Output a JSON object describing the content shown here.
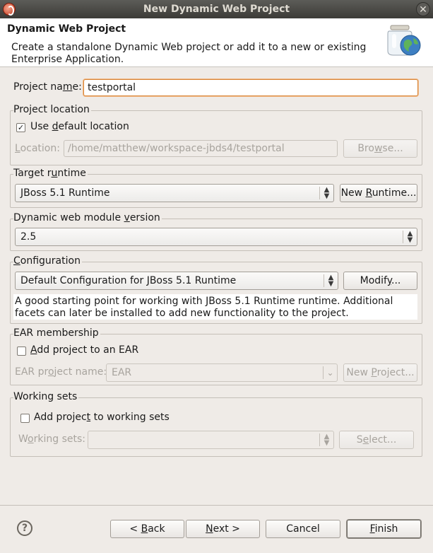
{
  "window": {
    "title": "New Dynamic Web Project"
  },
  "header": {
    "title": "Dynamic Web Project",
    "description": "Create a standalone Dynamic Web project or add it to a new or existing Enterprise Application."
  },
  "project_name": {
    "label_pre": "Project na",
    "label_mn": "m",
    "label_post": "e:",
    "value": "testportal"
  },
  "project_location": {
    "legend": "Project location",
    "use_default_pre": "Use ",
    "use_default_mn": "d",
    "use_default_post": "efault location",
    "use_default_checked": true,
    "location_pre": "",
    "location_mn": "L",
    "location_post": "ocation:",
    "location_value": "/home/matthew/workspace-jbds4/testportal",
    "browse_pre": "Bro",
    "browse_mn": "w",
    "browse_post": "se..."
  },
  "target_runtime": {
    "legend_pre": "Target r",
    "legend_mn": "u",
    "legend_post": "ntime",
    "selected": "JBoss 5.1 Runtime",
    "new_runtime_pre": "New ",
    "new_runtime_mn": "R",
    "new_runtime_post": "untime..."
  },
  "module_version": {
    "legend_pre": "Dynamic web module ",
    "legend_mn": "v",
    "legend_post": "ersion",
    "selected": "2.5"
  },
  "configuration": {
    "legend_pre": "",
    "legend_mn": "C",
    "legend_post": "onfiguration",
    "selected": "Default Configuration for JBoss 5.1 Runtime",
    "modify_pre": "Modif",
    "modify_mn": "y",
    "modify_post": "...",
    "description": "A good starting point for working with JBoss 5.1 Runtime runtime. Additional facets can later be installed to add new functionality to the project."
  },
  "ear": {
    "legend": "EAR membership",
    "add_pre": "",
    "add_mn": "A",
    "add_post": "dd project to an EAR",
    "add_checked": false,
    "ear_name_pre": "EAR pr",
    "ear_name_mn": "o",
    "ear_name_post": "ject name:",
    "ear_name_value": "EAR",
    "new_project_pre": "New ",
    "new_project_mn": "P",
    "new_project_post": "roject..."
  },
  "working_sets": {
    "legend": "Working sets",
    "add_pre": "Add projec",
    "add_mn": "t",
    "add_post": " to working sets",
    "add_checked": false,
    "sets_pre": "W",
    "sets_mn": "o",
    "sets_post": "rking sets:",
    "sets_value": "",
    "select_pre": "S",
    "select_mn": "e",
    "select_post": "lect..."
  },
  "footer": {
    "help_symbol": "?",
    "back_pre": "< ",
    "back_mn": "B",
    "back_post": "ack",
    "next_pre": "",
    "next_mn": "N",
    "next_post": "ext >",
    "cancel": "Cancel",
    "finish_pre": "",
    "finish_mn": "F",
    "finish_post": "inish"
  }
}
